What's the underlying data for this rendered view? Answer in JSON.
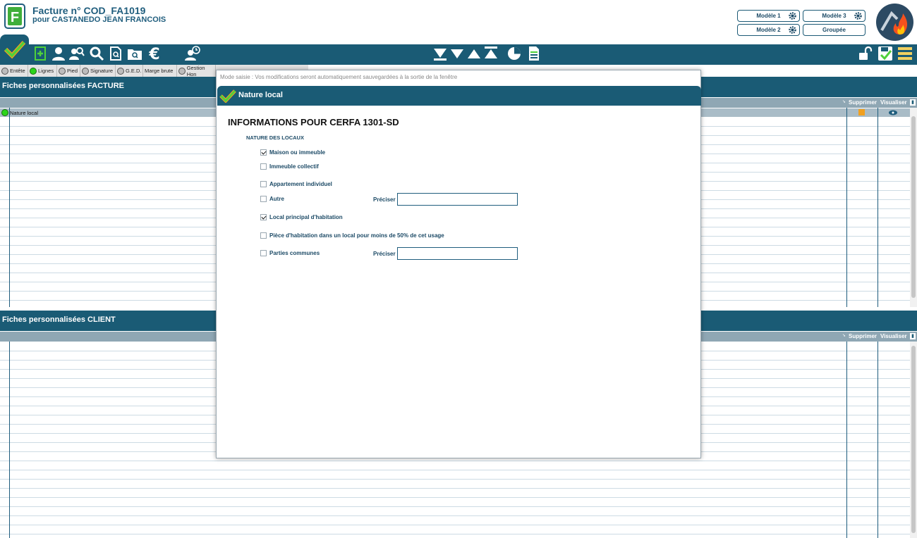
{
  "header": {
    "title": "Facture n° COD_FA1019",
    "subtitle": "pour CASTANEDO JEAN FRANCOIS",
    "template_buttons": [
      "Modèle 1",
      "Modèle 3",
      "Modèle 2",
      "Groupée"
    ]
  },
  "toolbar": {
    "icons": [
      "check-icon",
      "add-document-icon",
      "user-icon",
      "users-search-icon",
      "search-icon",
      "document-search-icon",
      "folder-search-icon",
      "euro-icon",
      "user-clock-icon",
      "arrow-bottom-icon",
      "arrow-down-icon",
      "arrow-up-icon",
      "arrow-top-icon",
      "pie-chart-icon",
      "spreadsheet-icon",
      "unlock-icon",
      "save-check-icon",
      "menu-icon"
    ]
  },
  "subtabs": [
    "Entête",
    "Lignes",
    "Pied",
    "Signature",
    "G.E.D.",
    "Marge brute",
    "Gestion Hon"
  ],
  "section_facture": {
    "title": "Fiches personnalisées FACTURE",
    "col_supprimer": "Supprimer",
    "col_visualiser": "Visualiser",
    "rows": [
      "Nature local"
    ]
  },
  "section_client": {
    "title": "Fiches personnalisées CLIENT",
    "col_supprimer": "Supprimer",
    "col_visualiser": "Visualiser"
  },
  "modal": {
    "hint": "Mode saisie : Vos modifications seront automatiquement sauvegardées à la sortie de la fenêtre",
    "title": "Nature local",
    "form_title": "INFORMATIONS POUR CERFA  1301-SD",
    "form_subtitle": "NATURE DES LOCAUX",
    "options": [
      {
        "label": "Maison ou immeuble",
        "checked": true
      },
      {
        "label": "Immeuble collectif",
        "checked": false
      },
      {
        "label": "Appartement individuel",
        "checked": false
      },
      {
        "label": "Autre",
        "checked": false
      },
      {
        "label": "Local principal d'habitation",
        "checked": true
      },
      {
        "label": "Pièce d'habitation dans un local pour moins de 50% de cet usage",
        "checked": false
      },
      {
        "label": "Parties communes",
        "checked": false
      }
    ],
    "preciser_label": "Préciser",
    "preciser_autre_value": "",
    "preciser_parties_value": ""
  },
  "colors": {
    "primary": "#1a5b75",
    "accent_green": "#2bd51b",
    "header_row": "#8fa7b4"
  }
}
